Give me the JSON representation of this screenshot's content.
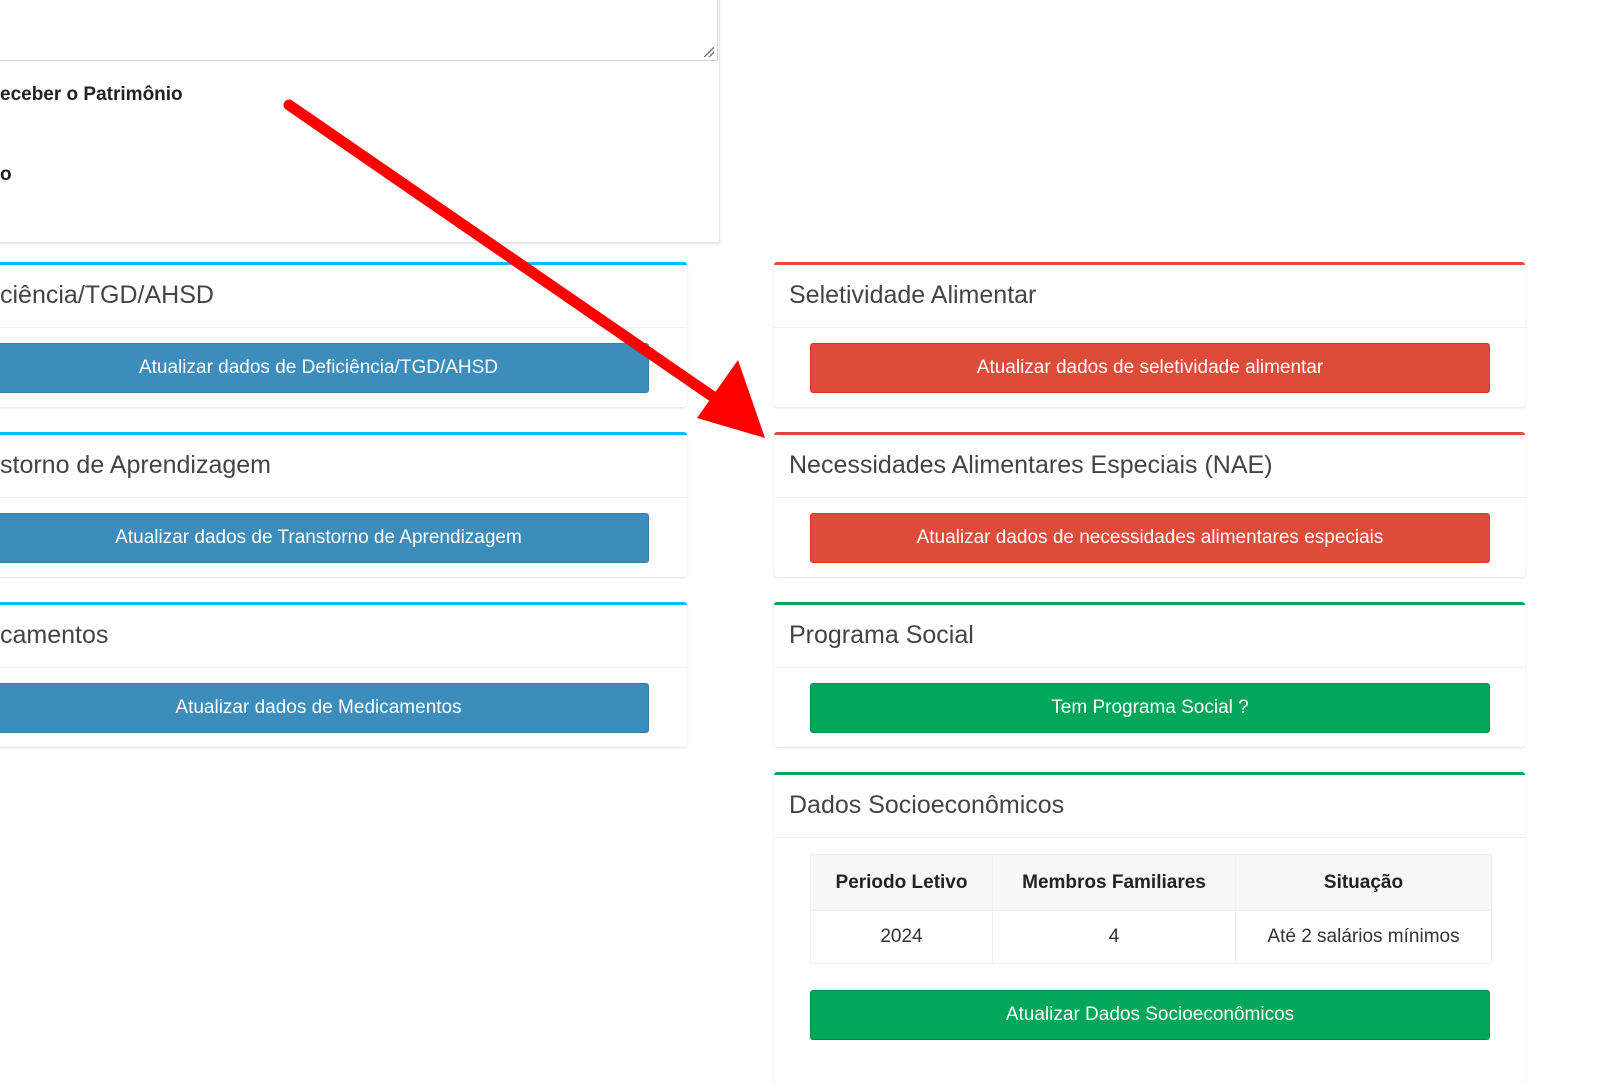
{
  "top": {
    "label1": "eceber o Patrimônio",
    "label2": "o"
  },
  "left_boxes": [
    {
      "title": "ciência/TGD/AHSD",
      "button": "Atualizar dados de Deficiência/TGD/AHSD"
    },
    {
      "title": "storno de Aprendizagem",
      "button": "Atualizar dados de Transtorno de Aprendizagem"
    },
    {
      "title": "camentos",
      "button": "Atualizar dados de Medicamentos"
    }
  ],
  "right_boxes": {
    "seletividade": {
      "title": "Seletividade Alimentar",
      "button": "Atualizar dados de seletividade alimentar"
    },
    "nae": {
      "title": "Necessidades Alimentares Especiais (NAE)",
      "button": "Atualizar dados de necessidades alimentares especiais"
    },
    "programa": {
      "title": "Programa Social",
      "button": "Tem Programa Social ?"
    },
    "socio": {
      "title": "Dados Socioeconômicos",
      "columns": [
        "Periodo Letivo",
        "Membros Familiares",
        "Situação"
      ],
      "rows": [
        [
          "2024",
          "4",
          "Até 2 salários mínimos"
        ]
      ],
      "button": "Atualizar Dados Socioeconômicos"
    }
  },
  "colors": {
    "info": "#00c0ef",
    "primary": "#3c8dbc",
    "danger": "#dd4b39",
    "success": "#00a65a",
    "arrow": "#ff0000"
  }
}
